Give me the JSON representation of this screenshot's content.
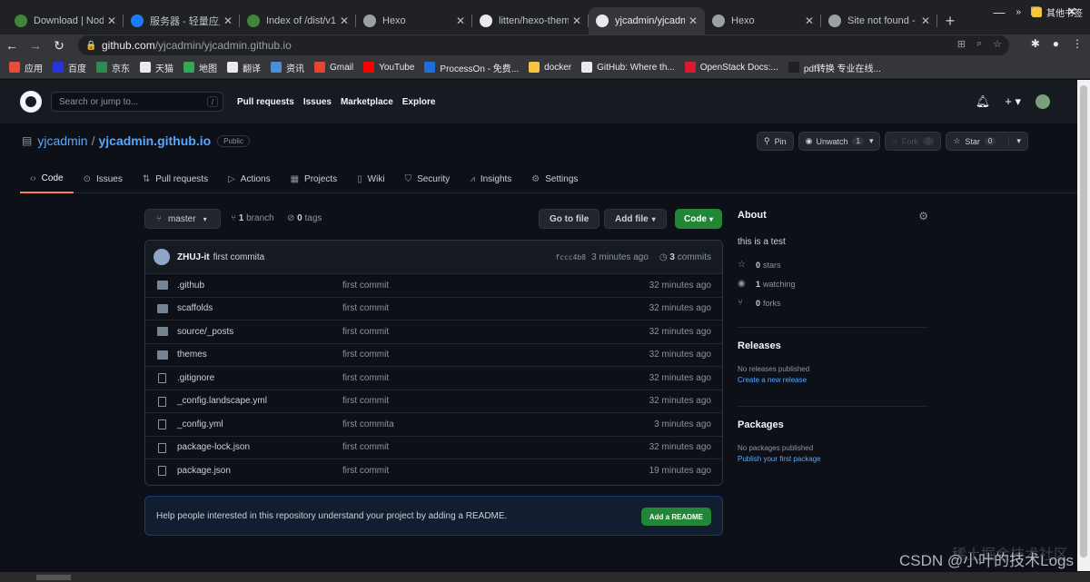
{
  "browser": {
    "tabs": [
      {
        "title": "Download | Node",
        "color": "#3c873a"
      },
      {
        "title": "服务器 - 轻量应用",
        "color": "#1a7cff"
      },
      {
        "title": "Index of /dist/v1",
        "color": "#3c873a"
      },
      {
        "title": "Hexo",
        "color": "#9aa0a6"
      },
      {
        "title": "litten/hexo-theme",
        "color": "#e8eaed"
      },
      {
        "title": "yjcadmin/yjcadmin",
        "color": "#e8eaed",
        "active": true
      },
      {
        "title": "Hexo",
        "color": "#9aa0a6"
      },
      {
        "title": "Site not found - G",
        "color": "#9aa0a6"
      }
    ],
    "url_host": "github.com",
    "url_path": "/yjcadmin/yjcadmin.github.io",
    "bookmarks": [
      {
        "label": "应用",
        "color": "#e74c3c"
      },
      {
        "label": "百度",
        "color": "#2932e1"
      },
      {
        "label": "京东",
        "color": "#2e8b57"
      },
      {
        "label": "天猫",
        "color": "#e8eaed"
      },
      {
        "label": "地图",
        "color": "#34a853"
      },
      {
        "label": "翻译",
        "color": "#e8eaed"
      },
      {
        "label": "资讯",
        "color": "#4a90d9"
      },
      {
        "label": "Gmail",
        "color": "#ea4335"
      },
      {
        "label": "YouTube",
        "color": "#ff0000"
      },
      {
        "label": "ProcessOn - 免费...",
        "color": "#1e6fd9"
      },
      {
        "label": "docker",
        "color": "#f4c542"
      },
      {
        "label": "GitHub: Where th...",
        "color": "#e8eaed"
      },
      {
        "label": "OpenStack Docs:...",
        "color": "#da1a32"
      },
      {
        "label": "pdf转换 专业在线...",
        "color": "#202124"
      }
    ],
    "bookmarks_other": "其他书签"
  },
  "github": {
    "search_placeholder": "Search or jump to...",
    "search_key": "/",
    "nav": [
      "Pull requests",
      "Issues",
      "Marketplace",
      "Explore"
    ],
    "owner": "yjcadmin",
    "repo": "yjcadmin.github.io",
    "visibility": "Public",
    "actions": {
      "pin": "Pin",
      "unwatch": "Unwatch",
      "watch_count": "1",
      "fork": "Fork",
      "fork_count": "0",
      "star": "Star",
      "star_count": "0"
    },
    "tabs": [
      "Code",
      "Issues",
      "Pull requests",
      "Actions",
      "Projects",
      "Wiki",
      "Security",
      "Insights",
      "Settings"
    ],
    "branch": "master",
    "branch_count": "1",
    "branch_label": "branch",
    "tag_count": "0",
    "tag_label": "tags",
    "go_to_file": "Go to file",
    "add_file": "Add file",
    "code_btn": "Code",
    "commit": {
      "author": "ZHUJ-it",
      "message": "first commita",
      "sha": "fccc4b8",
      "age": "3 minutes ago",
      "count": "3",
      "count_label": "commits"
    },
    "files": [
      {
        "name": ".github",
        "type": "dir",
        "msg": "first commit",
        "age": "32 minutes ago"
      },
      {
        "name": "scaffolds",
        "type": "dir",
        "msg": "first commit",
        "age": "32 minutes ago"
      },
      {
        "name": "source/_posts",
        "type": "dir",
        "msg": "first commit",
        "age": "32 minutes ago"
      },
      {
        "name": "themes",
        "type": "dir",
        "msg": "first commit",
        "age": "32 minutes ago"
      },
      {
        "name": ".gitignore",
        "type": "file",
        "msg": "first commit",
        "age": "32 minutes ago"
      },
      {
        "name": "_config.landscape.yml",
        "type": "file",
        "msg": "first commit",
        "age": "32 minutes ago"
      },
      {
        "name": "_config.yml",
        "type": "file",
        "msg": "first commita",
        "age": "3 minutes ago"
      },
      {
        "name": "package-lock.json",
        "type": "file",
        "msg": "first commit",
        "age": "32 minutes ago"
      },
      {
        "name": "package.json",
        "type": "file",
        "msg": "first commit",
        "age": "19 minutes ago"
      }
    ],
    "readme_text": "Help people interested in this repository understand your project by adding a README.",
    "readme_button": "Add a README",
    "about": {
      "title": "About",
      "description": "this is a test",
      "stars": "0",
      "stars_label": "stars",
      "watching": "1",
      "watching_label": "watching",
      "forks": "0",
      "forks_label": "forks"
    },
    "releases": {
      "title": "Releases",
      "empty": "No releases published",
      "link": "Create a new release"
    },
    "packages": {
      "title": "Packages",
      "empty": "No packages published",
      "link": "Publish your first package"
    }
  },
  "watermark": "CSDN @小叶的技术Logs",
  "watermark2": "稀土掘金技术社区"
}
